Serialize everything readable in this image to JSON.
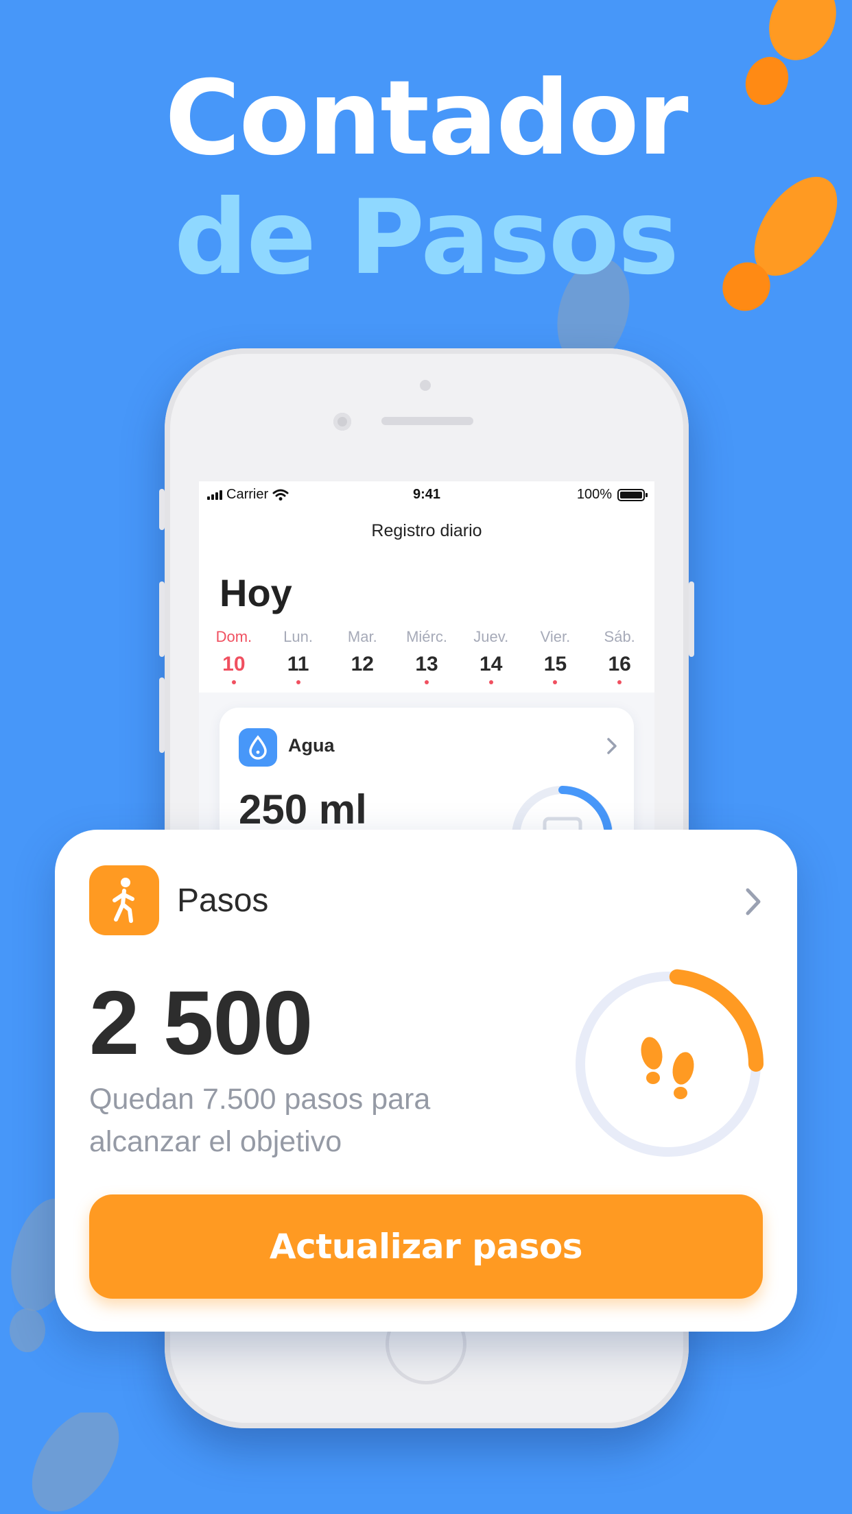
{
  "headline": {
    "line1": "Contador",
    "line2": "de Pasos"
  },
  "colors": {
    "background": "#4797f9",
    "accent_orange": "#ff9a22",
    "accent_light_blue": "#8fd8ff",
    "today_red": "#f05060",
    "water_blue": "#4797f9"
  },
  "status_bar": {
    "carrier": "Carrier",
    "time": "9:41",
    "battery": "100%"
  },
  "screen": {
    "nav_title": "Registro diario",
    "today_label": "Hoy",
    "week": [
      {
        "name": "Dom.",
        "num": "10",
        "active": true
      },
      {
        "name": "Lun.",
        "num": "11",
        "active": false
      },
      {
        "name": "Mar.",
        "num": "12",
        "active": false
      },
      {
        "name": "Miérc.",
        "num": "13",
        "active": false
      },
      {
        "name": "Juev.",
        "num": "14",
        "active": false
      },
      {
        "name": "Vier.",
        "num": "15",
        "active": false
      },
      {
        "name": "Sáb.",
        "num": "16",
        "active": false
      }
    ],
    "water_card": {
      "icon": "water-drop-icon",
      "label": "Agua",
      "value": "250 ml"
    }
  },
  "steps_card": {
    "icon": "walking-person-icon",
    "label": "Pasos",
    "value": "2 500",
    "subtitle_line1": "Quedan 7.500 pasos para",
    "subtitle_line2": "alcanzar el objetivo",
    "progress_fraction": 0.25,
    "ring_icon": "footprints-icon",
    "button_label": "Actualizar pasos"
  }
}
